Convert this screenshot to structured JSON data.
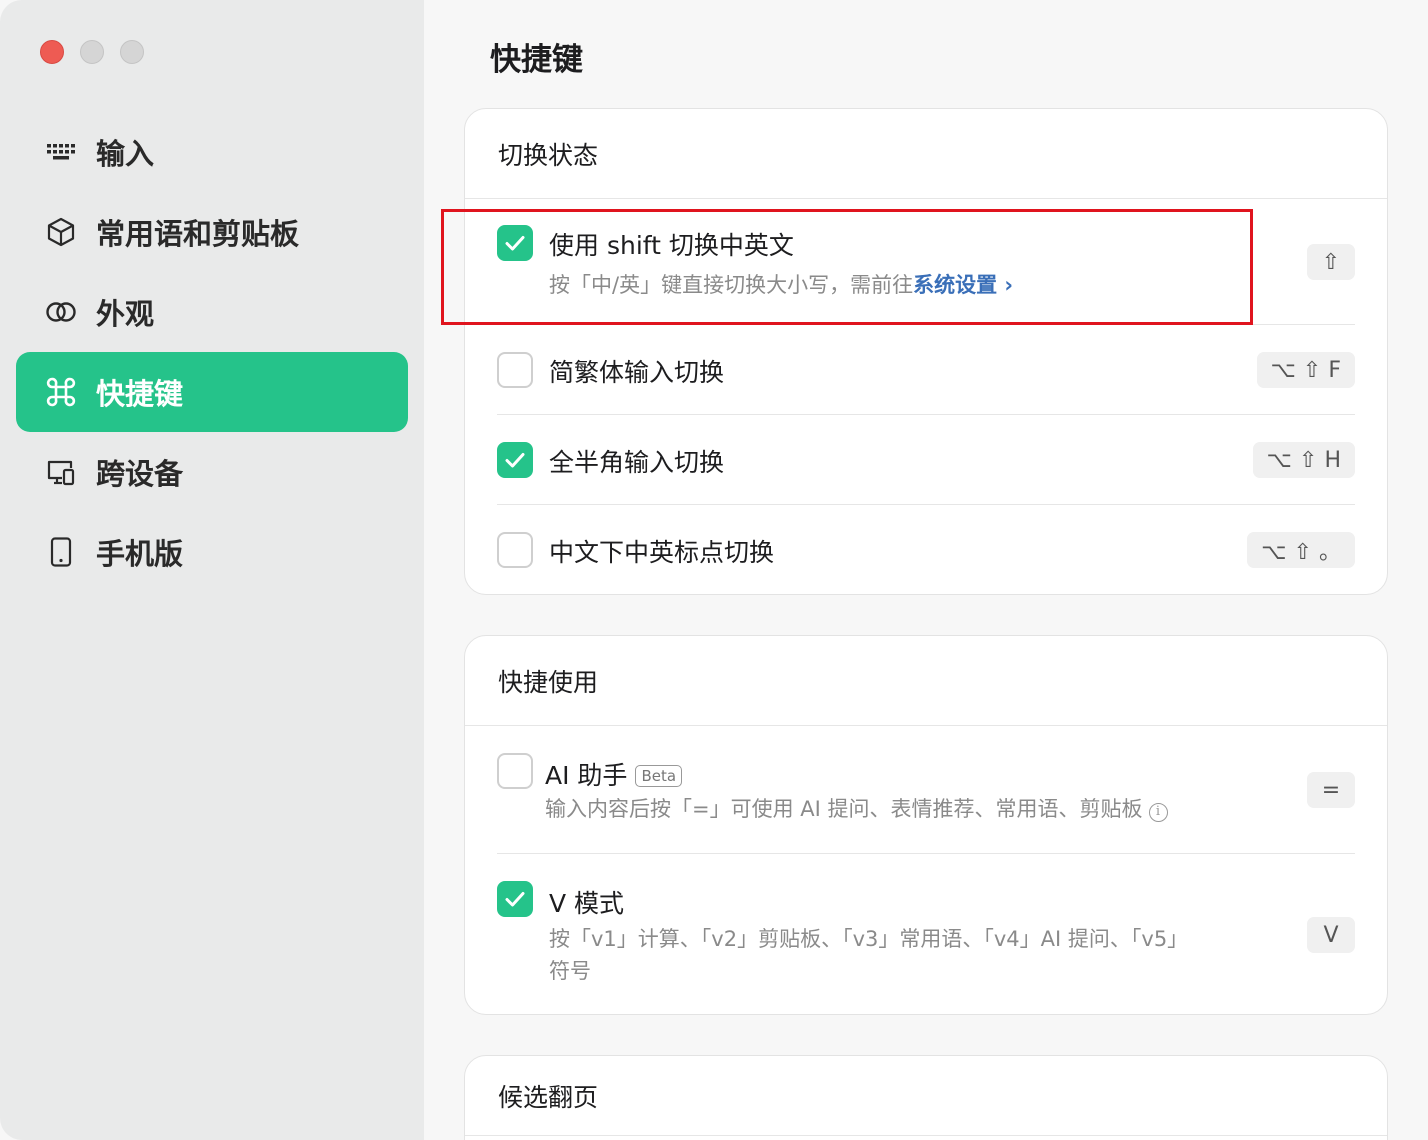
{
  "window": {
    "traffic_lights": [
      "close",
      "minimize",
      "maximize"
    ]
  },
  "sidebar": {
    "items": [
      {
        "label": "输入",
        "icon": "keyboard-icon",
        "active": false
      },
      {
        "label": "常用语和剪贴板",
        "icon": "cube-icon",
        "active": false
      },
      {
        "label": "外观",
        "icon": "overlapping-circles-icon",
        "active": false
      },
      {
        "label": "快捷键",
        "icon": "command-icon",
        "active": true
      },
      {
        "label": "跨设备",
        "icon": "devices-icon",
        "active": false
      },
      {
        "label": "手机版",
        "icon": "phone-icon",
        "active": false
      }
    ]
  },
  "main": {
    "title": "快捷键",
    "sections": [
      {
        "title": "切换状态",
        "rows": [
          {
            "title": "使用 shift 切换中英文",
            "checked": true,
            "subtitle": "按「中/英」键直接切换大小写，需前往",
            "link": "系统设置",
            "link_suffix": "›",
            "key": "⇧"
          },
          {
            "title": "简繁体输入切换",
            "checked": false,
            "key": "⌥ ⇧ F"
          },
          {
            "title": "全半角输入切换",
            "checked": true,
            "key": "⌥ ⇧ H"
          },
          {
            "title": "中文下中英标点切换",
            "checked": false,
            "key": "⌥ ⇧ 。"
          }
        ]
      },
      {
        "title": "快捷使用",
        "rows": [
          {
            "title": "AI 助手",
            "badge": "Beta",
            "checked": false,
            "subtitle": "输入内容后按「=」可使用 AI 提问、表情推荐、常用语、剪贴板",
            "info": "i",
            "key": "="
          },
          {
            "title": "V 模式",
            "checked": true,
            "subtitle_line1": "按「v1」计算、「v2」剪贴板、「v3」常用语、「v4」AI 提问、「v5」",
            "subtitle_line2": "符号",
            "key": "V"
          }
        ]
      },
      {
        "title": "候选翻页"
      }
    ]
  },
  "colors": {
    "accent": "#25c38a",
    "highlight_box": "#e0141e",
    "link": "#3a6fb8"
  }
}
